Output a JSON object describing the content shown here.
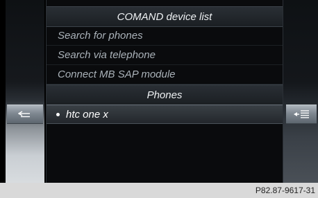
{
  "device_list": {
    "title": "COMAND device list",
    "menu_items": [
      "Search for phones",
      "Search via telephone",
      "Connect MB SAP module"
    ]
  },
  "phones": {
    "title": "Phones",
    "items": [
      {
        "label": "htc one x",
        "selected": true
      }
    ]
  },
  "side_buttons": {
    "left_icon": "back-icon",
    "right_icon": "options-list-icon"
  },
  "figure_code": "P82.87-9617-31"
}
